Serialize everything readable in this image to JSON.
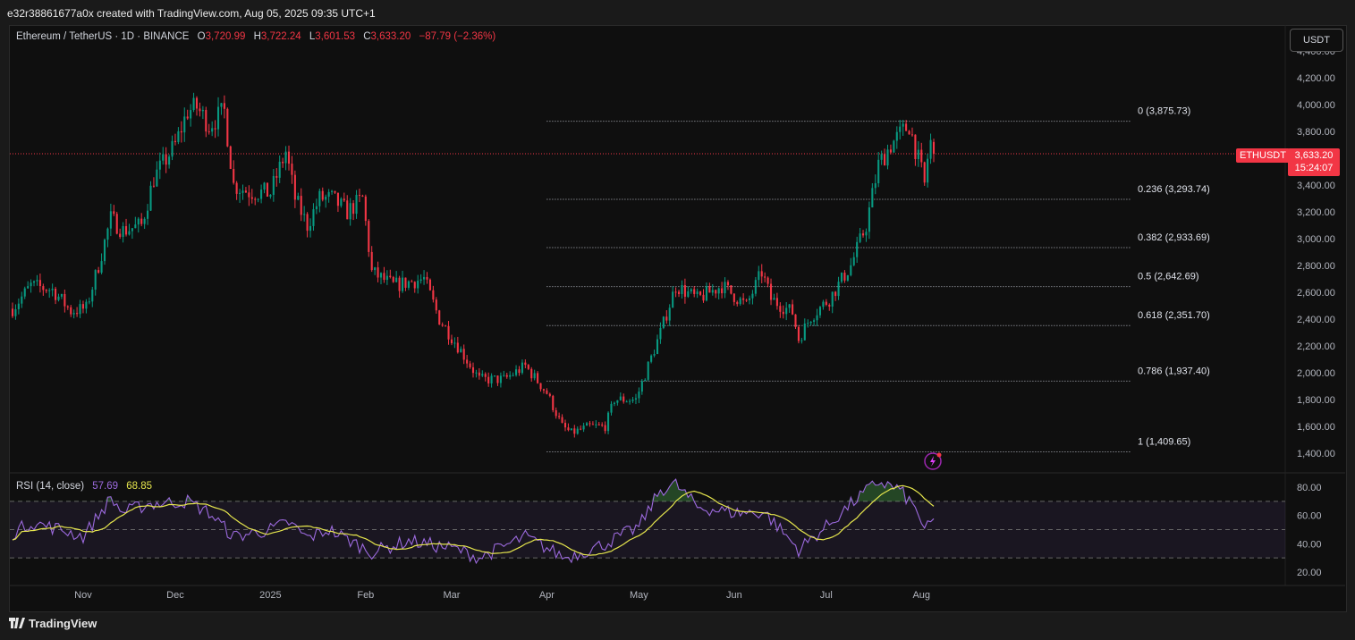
{
  "watermark": "e32r38861677a0x created with TradingView.com, Aug 05, 2025 09:35 UTC+1",
  "header": {
    "symbol": "Ethereum / TetherUS · 1D · BINANCE",
    "open_label": "O",
    "open": "3,720.99",
    "high_label": "H",
    "high": "3,722.24",
    "low_label": "L",
    "low": "3,601.53",
    "close_label": "C",
    "close": "3,633.20",
    "change": "−87.79 (−2.36%)"
  },
  "currency_button": "USDT",
  "price_axis": [
    "4,200.00",
    "4,000.00",
    "3,800.00",
    "3,600.00",
    "3,400.00",
    "3,200.00",
    "3,000.00",
    "2,800.00",
    "2,600.00",
    "2,400.00",
    "2,200.00",
    "2,000.00",
    "1,800.00",
    "1,600.00",
    "1,400.00"
  ],
  "price_axis_partial": "4,400.00",
  "last_price": {
    "symbol": "ETHUSDT",
    "price": "3,633.20",
    "countdown": "15:24:07"
  },
  "fib_levels": [
    {
      "label": "0 (3,875.73)",
      "value": 3875.73
    },
    {
      "label": "0.236 (3,293.74)",
      "value": 3293.74
    },
    {
      "label": "0.382 (2,933.69)",
      "value": 2933.69
    },
    {
      "label": "0.5 (2,642.69)",
      "value": 2642.69
    },
    {
      "label": "0.618 (2,351.70)",
      "value": 2351.7
    },
    {
      "label": "0.786 (1,937.40)",
      "value": 1937.4
    },
    {
      "label": "1 (1,409.65)",
      "value": 1409.65
    }
  ],
  "rsi": {
    "label": "RSI (14, close)",
    "value": "57.69",
    "ma_value": "68.85",
    "axis": [
      "80.00",
      "60.00",
      "40.00",
      "20.00"
    ]
  },
  "time_axis": [
    "Nov",
    "Dec",
    "2025",
    "Feb",
    "Mar",
    "Apr",
    "May",
    "Jun",
    "Jul",
    "Aug"
  ],
  "brand": "TradingView",
  "colors": {
    "up": "#089981",
    "down": "#f23645",
    "rsi": "#9c6ade",
    "rsi_ma": "#e6e64d",
    "fib": "#b2b5be"
  },
  "chart_data": {
    "type": "candlestick",
    "interval": "1D",
    "anchors": [
      [
        "2024-10-07",
        2420
      ],
      [
        "2024-10-15",
        2650
      ],
      [
        "2024-10-22",
        2620
      ],
      [
        "2024-10-28",
        2460
      ],
      [
        "2024-11-02",
        2480
      ],
      [
        "2024-11-06",
        2800
      ],
      [
        "2024-11-10",
        3150
      ],
      [
        "2024-11-14",
        3060
      ],
      [
        "2024-11-20",
        3100
      ],
      [
        "2024-11-24",
        3450
      ],
      [
        "2024-12-01",
        3700
      ],
      [
        "2024-12-05",
        3950
      ],
      [
        "2024-12-08",
        3980
      ],
      [
        "2024-12-12",
        3850
      ],
      [
        "2024-12-17",
        3950
      ],
      [
        "2024-12-20",
        3400
      ],
      [
        "2024-12-25",
        3350
      ],
      [
        "2025-01-01",
        3340
      ],
      [
        "2025-01-06",
        3650
      ],
      [
        "2025-01-09",
        3300
      ],
      [
        "2025-01-13",
        3100
      ],
      [
        "2025-01-17",
        3300
      ],
      [
        "2025-01-21",
        3300
      ],
      [
        "2025-01-26",
        3200
      ],
      [
        "2025-01-31",
        3300
      ],
      [
        "2025-02-03",
        2750
      ],
      [
        "2025-02-10",
        2650
      ],
      [
        "2025-02-20",
        2700
      ],
      [
        "2025-02-25",
        2400
      ],
      [
        "2025-03-03",
        2200
      ],
      [
        "2025-03-10",
        1950
      ],
      [
        "2025-03-18",
        1950
      ],
      [
        "2025-03-25",
        2050
      ],
      [
        "2025-04-01",
        1850
      ],
      [
        "2025-04-06",
        1600
      ],
      [
        "2025-04-09",
        1550
      ],
      [
        "2025-04-15",
        1600
      ],
      [
        "2025-04-20",
        1600
      ],
      [
        "2025-04-23",
        1800
      ],
      [
        "2025-04-30",
        1800
      ],
      [
        "2025-05-08",
        2300
      ],
      [
        "2025-05-13",
        2650
      ],
      [
        "2025-05-20",
        2550
      ],
      [
        "2025-05-28",
        2650
      ],
      [
        "2025-06-05",
        2500
      ],
      [
        "2025-06-10",
        2750
      ],
      [
        "2025-06-13",
        2550
      ],
      [
        "2025-06-20",
        2450
      ],
      [
        "2025-06-22",
        2250
      ],
      [
        "2025-06-26",
        2420
      ],
      [
        "2025-07-02",
        2550
      ],
      [
        "2025-07-09",
        2800
      ],
      [
        "2025-07-14",
        3100
      ],
      [
        "2025-07-18",
        3550
      ],
      [
        "2025-07-22",
        3700
      ],
      [
        "2025-07-28",
        3850
      ],
      [
        "2025-08-01",
        3500
      ],
      [
        "2025-08-02",
        3400
      ],
      [
        "2025-08-03",
        3600
      ],
      [
        "2025-08-04",
        3720
      ],
      [
        "2025-08-05",
        3633
      ]
    ],
    "rsi_anchors": [
      [
        "2024-10-07",
        45
      ],
      [
        "2024-10-15",
        55
      ],
      [
        "2024-10-25",
        50
      ],
      [
        "2024-11-01",
        45
      ],
      [
        "2024-11-10",
        72
      ],
      [
        "2024-11-14",
        62
      ],
      [
        "2024-11-22",
        68
      ],
      [
        "2024-12-05",
        70
      ],
      [
        "2024-12-12",
        62
      ],
      [
        "2024-12-20",
        45
      ],
      [
        "2025-01-01",
        50
      ],
      [
        "2025-01-07",
        55
      ],
      [
        "2025-01-13",
        44
      ],
      [
        "2025-01-20",
        50
      ],
      [
        "2025-02-03",
        34
      ],
      [
        "2025-02-15",
        42
      ],
      [
        "2025-03-03",
        36
      ],
      [
        "2025-03-10",
        30
      ],
      [
        "2025-03-25",
        45
      ],
      [
        "2025-04-07",
        30
      ],
      [
        "2025-04-20",
        40
      ],
      [
        "2025-05-01",
        52
      ],
      [
        "2025-05-08",
        78
      ],
      [
        "2025-05-13",
        82
      ],
      [
        "2025-05-20",
        66
      ],
      [
        "2025-06-01",
        62
      ],
      [
        "2025-06-11",
        62
      ],
      [
        "2025-06-22",
        36
      ],
      [
        "2025-07-01",
        52
      ],
      [
        "2025-07-10",
        70
      ],
      [
        "2025-07-18",
        84
      ],
      [
        "2025-07-25",
        78
      ],
      [
        "2025-07-31",
        62
      ],
      [
        "2025-08-02",
        48
      ],
      [
        "2025-08-05",
        57.69
      ]
    ],
    "y_range": [
      1300,
      4450
    ],
    "rsi_range": [
      10,
      90
    ],
    "rsi_bands": [
      70,
      50,
      30
    ]
  }
}
